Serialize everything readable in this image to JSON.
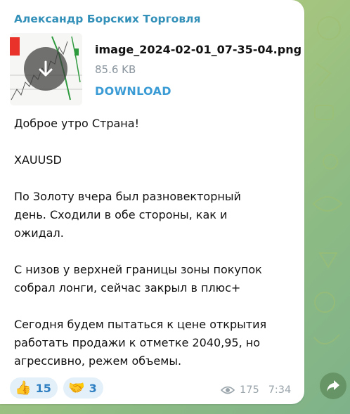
{
  "message": {
    "sender": "Александр Борских Торговля",
    "attachment": {
      "file_name": "image_2024-02-01_07-35-04.png",
      "file_size": "85.6 KB",
      "download_label": "DOWNLOAD",
      "icon": "download-arrow-icon"
    },
    "lines": [
      "Доброе утро Страна!",
      "",
      "XAUUSD",
      "",
      "По Золоту вчера был разновекторный",
      "день. Сходили в обе стороны, как и",
      "ожидал.",
      "",
      "С низов у верхней границы зоны покупок",
      "собрал лонги, сейчас закрыл в плюс+",
      "",
      "Сегодня будем пытаться к цене открытия",
      "работать продажи к отметке 2040,95, но",
      "агрессивно, режем объемы."
    ],
    "reactions": [
      {
        "emoji": "👍",
        "count": "15",
        "icon": "thumbs-up-icon"
      },
      {
        "emoji": "🤝",
        "count": "3",
        "icon": "handshake-icon"
      }
    ],
    "views": "175",
    "time": "7:34"
  },
  "colors": {
    "sender": "#3390b8",
    "link": "#3a9bd5",
    "meta": "#9aa4ab",
    "reaction_bg": "#e3f0fa",
    "reaction_text": "#2f7fc1"
  }
}
